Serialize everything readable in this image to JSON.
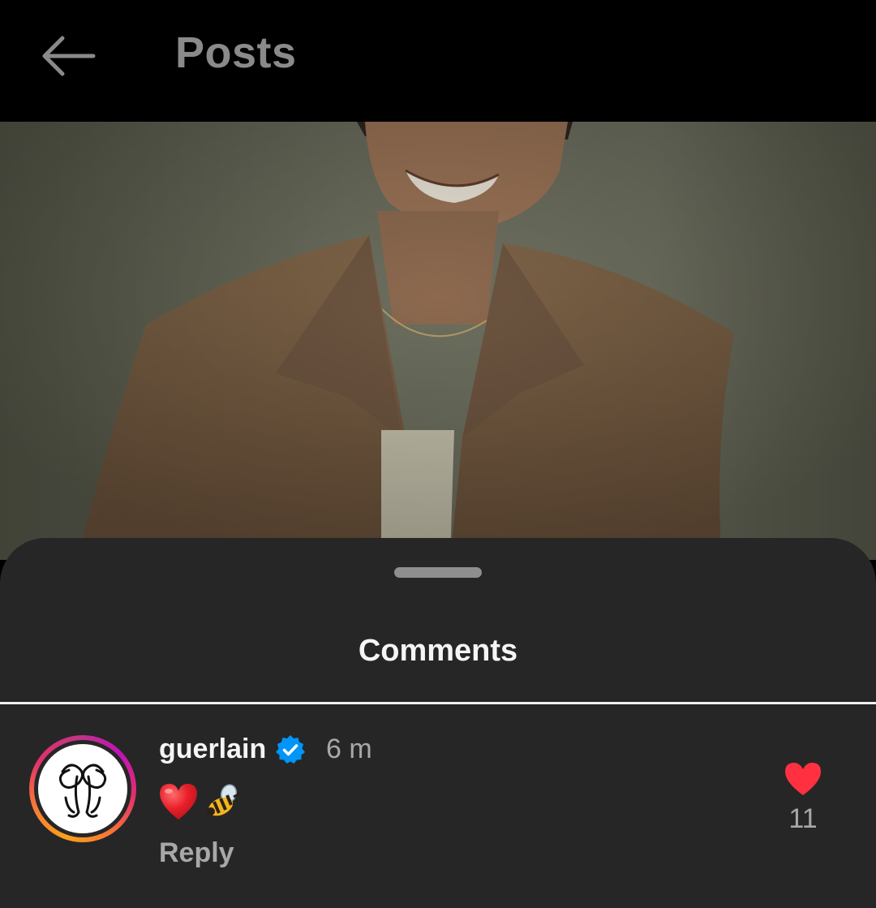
{
  "header": {
    "title": "Posts",
    "back_icon": "arrow-left-icon"
  },
  "post": {
    "media_description_icon": "video-still"
  },
  "comments_sheet": {
    "title": "Comments",
    "comments": [
      {
        "username": "guerlain",
        "verified": true,
        "timestamp": "6 m",
        "body_icons": [
          "red-heart-emoji",
          "bee-emoji"
        ],
        "reply_label": "Reply",
        "like_icon": "heart-filled-icon",
        "like_count": "11"
      }
    ]
  },
  "colors": {
    "background": "#000000",
    "sheet": "#262626",
    "title_gray": "#8a8a8a",
    "secondary_text": "#a8a8a8",
    "verified_blue": "#0095f6",
    "like_red": "#ff3040"
  }
}
